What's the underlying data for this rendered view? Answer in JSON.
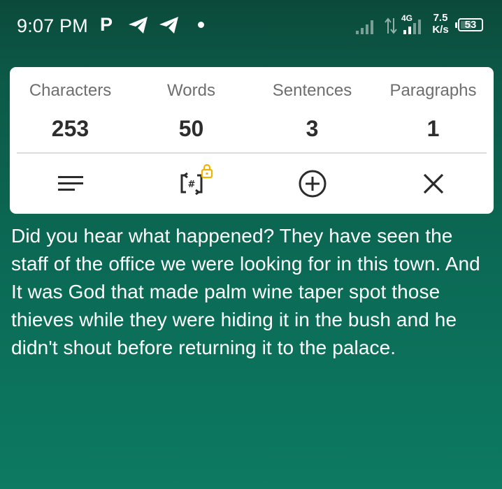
{
  "status_bar": {
    "time": "9:07 PM",
    "app_icon_letter": "P",
    "network_type": "4G",
    "speed_value": "7.5",
    "speed_unit": "K/s",
    "battery_level": "53",
    "icons": [
      "p-app-icon",
      "telegram-icon",
      "telegram-icon",
      "notification-dot-icon",
      "signal-bars-icon",
      "data-transfer-icon",
      "signal-bars-icon",
      "battery-icon"
    ]
  },
  "stats": {
    "characters": {
      "label": "Characters",
      "value": "253"
    },
    "words": {
      "label": "Words",
      "value": "50"
    },
    "sentences": {
      "label": "Sentences",
      "value": "3"
    },
    "paragraphs": {
      "label": "Paragraphs",
      "value": "1"
    }
  },
  "actions": [
    {
      "icon": "menu-lines-icon"
    },
    {
      "icon": "hash-count-locked-icon"
    },
    {
      "icon": "add-circle-icon"
    },
    {
      "icon": "close-icon"
    }
  ],
  "colors": {
    "background_top": "#0b4a3b",
    "background_bottom": "#0d7a61",
    "card": "#ffffff",
    "lock_badge": "#f0b400"
  },
  "content": {
    "text": "Did you hear what happened? They have seen the staff of the office we were looking for in this town. And It was God that made palm wine taper spot those thieves while they were hiding it in the bush and he didn't shout before returning it to the palace."
  }
}
